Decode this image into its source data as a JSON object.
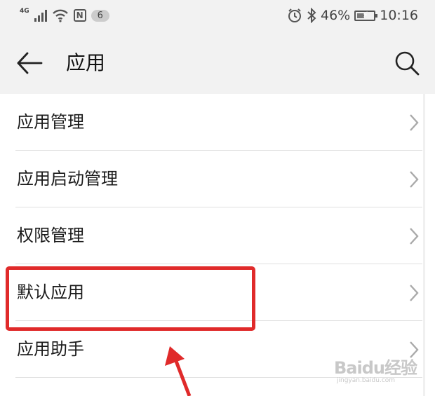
{
  "status_bar": {
    "network": "4G",
    "notification_count": "6",
    "battery_percent": "46%",
    "battery_level": 0.46,
    "time": "10:16",
    "icons": [
      "signal-icon",
      "wifi-icon",
      "nfc-icon",
      "alarm-icon",
      "bluetooth-icon",
      "battery-icon"
    ]
  },
  "app_bar": {
    "title": "应用",
    "back_icon": "arrow-left-icon",
    "search_icon": "search-icon"
  },
  "list": {
    "items": [
      {
        "label": "应用管理"
      },
      {
        "label": "应用启动管理"
      },
      {
        "label": "权限管理"
      },
      {
        "label": "默认应用",
        "highlighted": true
      },
      {
        "label": "应用助手"
      }
    ],
    "chevron_icon": "chevron-right-icon"
  },
  "annotation": {
    "highlight_color": "#e02a2a",
    "arrow_color": "#e02a2a"
  },
  "watermark": {
    "text": "Baidu经验",
    "subtext": "jingyan.baidu.com"
  }
}
